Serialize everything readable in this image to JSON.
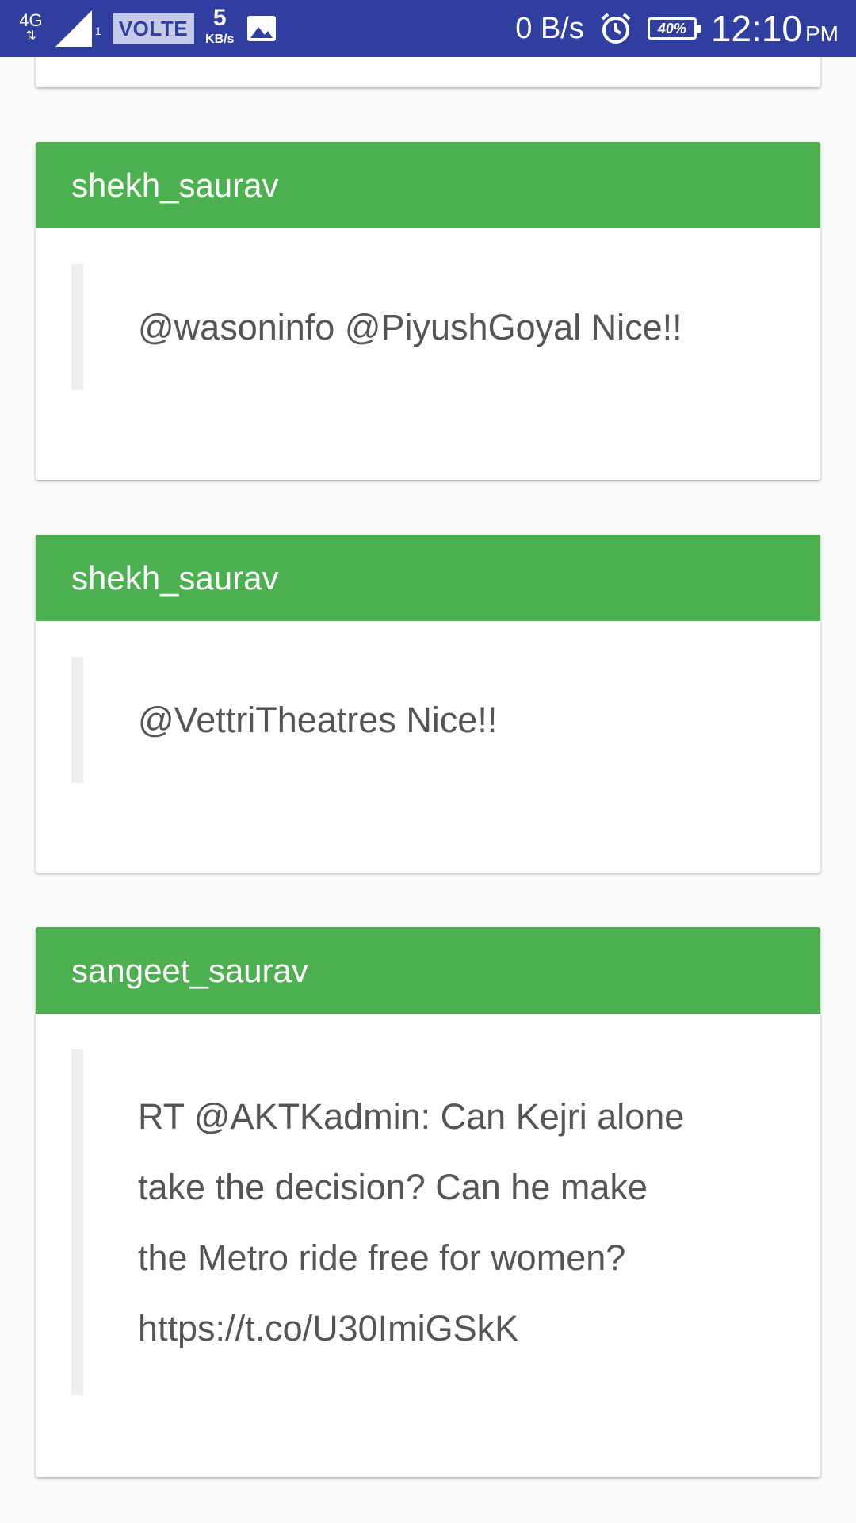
{
  "status_bar": {
    "network_type": "4G",
    "sim_slot": "1",
    "volte_label": "VOLTE",
    "data_rate_value": "5",
    "data_rate_unit": "KB/s",
    "speed": "0 B/s",
    "battery": "40%",
    "time": "12:10",
    "ampm": "PM"
  },
  "posts": [
    {
      "username": "shekh_saurav",
      "text": "@wasoninfo @PiyushGoyal Nice!!"
    },
    {
      "username": "shekh_saurav",
      "text": "@VettriTheatres Nice!!"
    },
    {
      "username": "sangeet_saurav",
      "text": "RT @AKTKadmin: Can Kejri alone take the decision? Can he make the Metro ride free for women? https://t.co/U30ImiGSkK"
    }
  ],
  "colors": {
    "status_bar": "#303f9f",
    "card_header": "#4caf50",
    "quote_text": "#555555"
  },
  "icons": [
    "signal-icon",
    "image-icon",
    "alarm-icon",
    "battery-icon"
  ]
}
